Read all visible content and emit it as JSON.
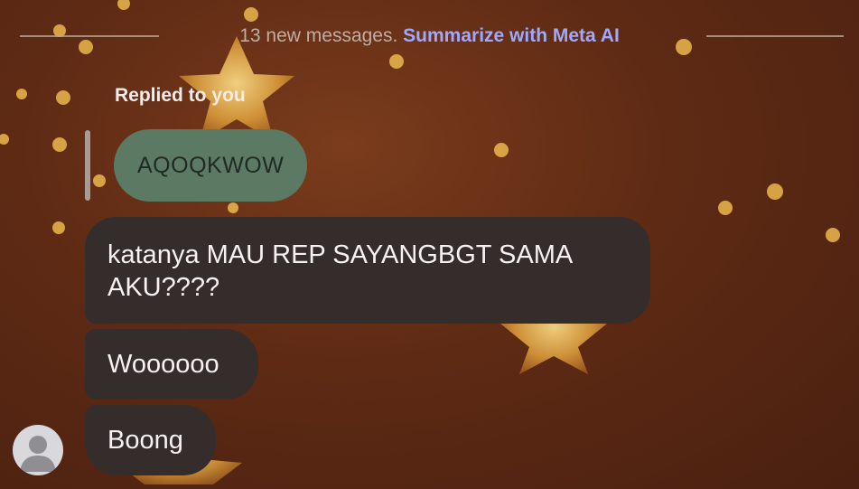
{
  "banner": {
    "count_text": "13 new messages.",
    "summarize_label": "Summarize with Meta AI"
  },
  "reply": {
    "label": "Replied to you",
    "quoted_text": "AQOQKWOW"
  },
  "messages": [
    {
      "line1": "katanya MAU REP SAYANGBGT SAMA",
      "line2": "AKU????"
    },
    {
      "text": "Woooooo"
    },
    {
      "text": "Boong"
    }
  ],
  "colors": {
    "bubble": "#352d2b",
    "quoted_bubble": "#5c7a63",
    "link": "#9fa8ff",
    "background": "#5e2a14"
  },
  "icons": {
    "avatar": "default-user-avatar-icon"
  }
}
